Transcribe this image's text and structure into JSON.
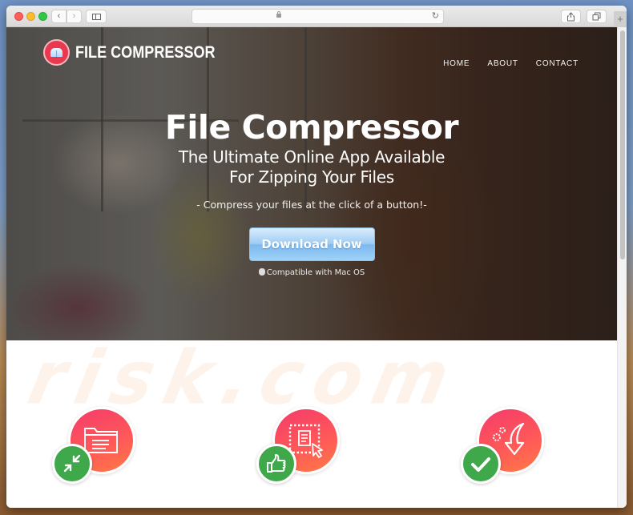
{
  "browser": {
    "address_bar": "",
    "new_tab_label": "+"
  },
  "site": {
    "logo_text": "FILE COMPRESSOR",
    "nav": [
      {
        "label": "HOME"
      },
      {
        "label": "ABOUT"
      },
      {
        "label": "CONTACT"
      }
    ]
  },
  "hero": {
    "title": "File Compressor",
    "subtitle_line1": "The Ultimate Online App Available",
    "subtitle_line2": "For Zipping Your Files",
    "tagline": "- Compress your files at the click of a button!-",
    "download_button": "Download Now",
    "compatibility": "Compatible with Mac OS"
  },
  "watermark": "risk.com",
  "features": [
    {
      "main_icon": "folder-document-icon",
      "badge_icon": "compress-arrows-icon"
    },
    {
      "main_icon": "select-document-cursor-icon",
      "badge_icon": "thumbs-up-icon"
    },
    {
      "main_icon": "gears-download-arrow-icon",
      "badge_icon": "checkmark-icon"
    }
  ],
  "colors": {
    "feature_gradient_start": "#f53b6b",
    "feature_gradient_end": "#ff7a45",
    "badge_green": "#3fa84b",
    "download_blue": "#7cb9ee",
    "logo_red": "#e8394f"
  }
}
